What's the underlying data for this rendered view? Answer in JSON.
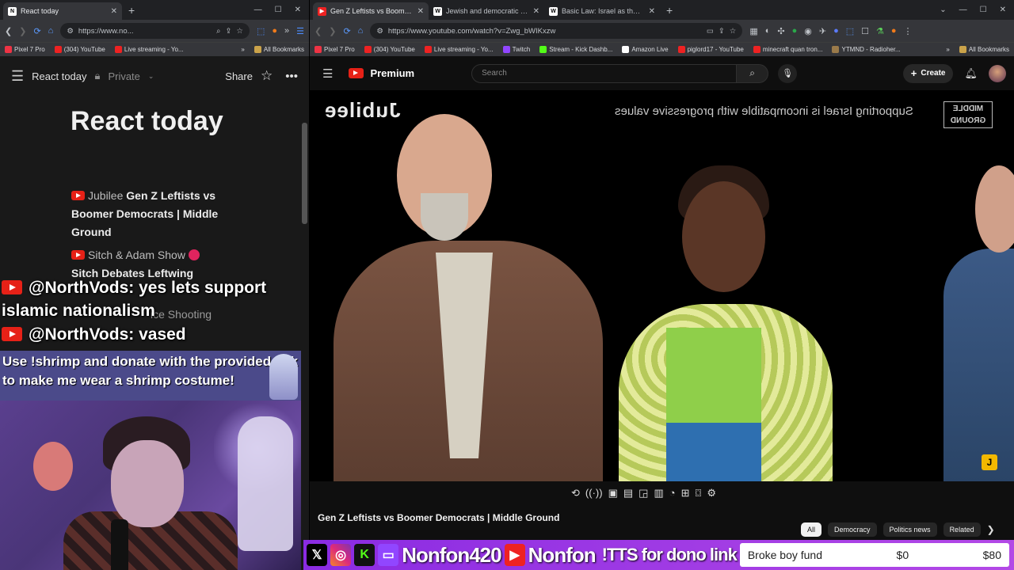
{
  "left_browser": {
    "tab_title": "React today",
    "url": "https://www.no...",
    "bookmarks": [
      "Pixel 7 Pro",
      "(304) YouTube",
      "Live streaming - Yo..."
    ],
    "all_bookmarks": "All Bookmarks",
    "notion": {
      "page_name": "React today",
      "privacy": "Private",
      "share": "Share",
      "title": "React today",
      "items": [
        {
          "source": "Jubilee",
          "title": "Gen Z Leftists vs Boomer Democrats | Middle Ground"
        },
        {
          "source": "Sitch & Adam Show",
          "title": "Sitch Debates Leftwing"
        }
      ],
      "faded_text": "ice Shooting"
    }
  },
  "chat": [
    {
      "user": "@NorthVods:",
      "message": "yes lets support",
      "continuation": "islamic nationalism"
    },
    {
      "user": "@NorthVods:",
      "message": "vased"
    }
  ],
  "shrimp_banner": "Use !shrimp and donate with the provided link to make me wear a shrimp costume!",
  "right_browser": {
    "tabs": [
      {
        "title": "Gen Z Leftists vs Boomer D",
        "active": true,
        "favicon": "youtube"
      },
      {
        "title": "Jewish and democratic state - W",
        "active": false,
        "favicon": "W"
      },
      {
        "title": "Basic Law: Israel as the Nation",
        "active": false,
        "favicon": "W"
      }
    ],
    "url": "https://www.youtube.com/watch?v=Zwg_bWIKxzw",
    "bookmarks": [
      "Pixel 7 Pro",
      "(304) YouTube",
      "Live streaming - Yo...",
      "Twitch",
      "Stream - Kick Dashb...",
      "Amazon Live",
      "piglord17 - YouTube",
      "minecraft quan tron...",
      "YTMND - Radioher..."
    ],
    "all_bookmarks": "All Bookmarks"
  },
  "youtube": {
    "logo": "Premium",
    "search_placeholder": "Search",
    "create": "Create",
    "video_overlay": {
      "brand": "Jubilee",
      "caption": "Supporting Israel is incompatible with progressive values",
      "show_logo": "MIDDLE GROUND"
    },
    "video_title": "Gen Z Leftists vs Boomer Democrats | Middle Ground",
    "channel": "Jubilee",
    "chips": [
      "All",
      "Democracy",
      "Politics news",
      "Related"
    ]
  },
  "stream_bar": {
    "handle_main": "Nonfon420",
    "handle_short": "Nonfon",
    "tts": "!TTS for dono link",
    "fund_name": "Broke boy fund",
    "fund_current": "$0",
    "fund_goal": "$80"
  }
}
